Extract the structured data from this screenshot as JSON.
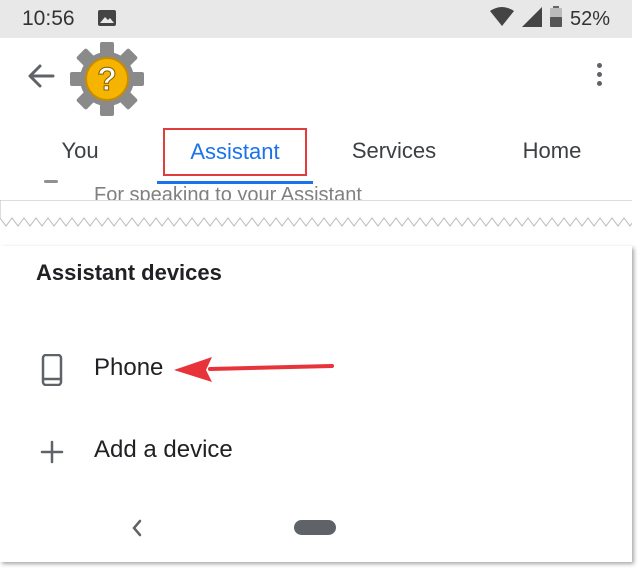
{
  "status_bar": {
    "time": "10:56",
    "battery_percent": "52%",
    "icons": [
      "image-icon",
      "wifi-icon",
      "signal-icon",
      "battery-icon"
    ]
  },
  "app_bar": {
    "logo_icon": "gear-question-icon",
    "back_icon": "back-arrow-icon",
    "menu_icon": "more-vert-icon"
  },
  "tabs": [
    {
      "label": "You",
      "selected": false
    },
    {
      "label": "Assistant",
      "selected": true
    },
    {
      "label": "Services",
      "selected": false
    },
    {
      "label": "Home",
      "selected": false
    }
  ],
  "peek": {
    "text": "For speaking to your Assistant"
  },
  "devices_section": {
    "title": "Assistant devices",
    "items": [
      {
        "label": "Phone",
        "icon": "phone-icon"
      },
      {
        "label": "Add a device",
        "icon": "plus-icon"
      }
    ]
  },
  "nav_bar": {
    "back_icon": "nav-back-icon",
    "home_icon": "nav-home-pill"
  },
  "colors": {
    "accent": "#1a73e8",
    "highlight_box": "#e23c3c",
    "annotation_arrow": "#e8333a",
    "logo_gear": "#8a8a8a",
    "logo_badge": "#f5b400"
  }
}
